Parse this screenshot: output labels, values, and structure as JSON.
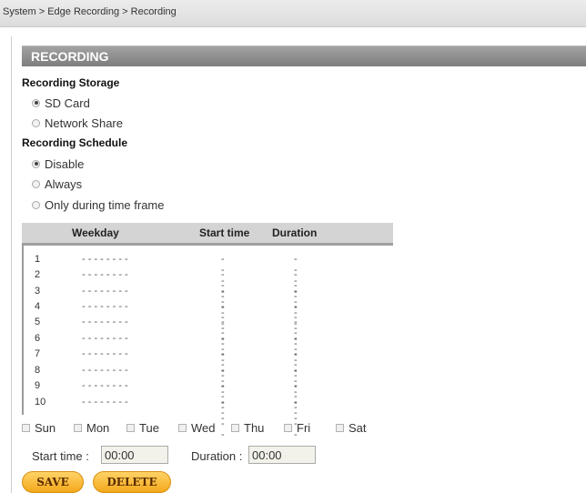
{
  "breadcrumb": "System > Edge Recording > Recording",
  "header": {
    "title": "RECORDING"
  },
  "storage": {
    "label": "Recording Storage",
    "options": [
      {
        "label": "SD Card",
        "selected": true
      },
      {
        "label": "Network Share",
        "selected": false
      }
    ]
  },
  "schedule": {
    "label": "Recording Schedule",
    "options": [
      {
        "label": "Disable",
        "selected": true
      },
      {
        "label": "Always",
        "selected": false
      },
      {
        "label": "Only during time frame",
        "selected": false
      }
    ]
  },
  "table": {
    "headers": {
      "weekday": "Weekday",
      "start_time": "Start time",
      "duration": "Duration"
    },
    "rows": [
      {
        "num": "1",
        "weekday": "- - - - - - - -",
        "start": "----",
        "duration": "----"
      },
      {
        "num": "2",
        "weekday": "- - - - - - - -",
        "start": "----",
        "duration": "----"
      },
      {
        "num": "3",
        "weekday": "- - - - - - - -",
        "start": "----",
        "duration": "----"
      },
      {
        "num": "4",
        "weekday": "- - - - - - - -",
        "start": "----",
        "duration": "----"
      },
      {
        "num": "5",
        "weekday": "- - - - - - - -",
        "start": "----",
        "duration": "----"
      },
      {
        "num": "6",
        "weekday": "- - - - - - - -",
        "start": "----",
        "duration": "----"
      },
      {
        "num": "7",
        "weekday": "- - - - - - - -",
        "start": "----",
        "duration": "----"
      },
      {
        "num": "8",
        "weekday": "- - - - - - - -",
        "start": "----",
        "duration": "----"
      },
      {
        "num": "9",
        "weekday": "- - - - - - - -",
        "start": "----",
        "duration": "----"
      },
      {
        "num": "10",
        "weekday": "- - - - - - - -",
        "start": "----",
        "duration": "----"
      }
    ]
  },
  "days": [
    "Sun",
    "Mon",
    "Tue",
    "Wed",
    "Thu",
    "Fri",
    "Sat"
  ],
  "time": {
    "start_label": "Start time :",
    "start_value": "00:00",
    "duration_label": "Duration :",
    "duration_value": "00:00"
  },
  "buttons": {
    "save": "SAVE",
    "delete": "DELETE"
  }
}
